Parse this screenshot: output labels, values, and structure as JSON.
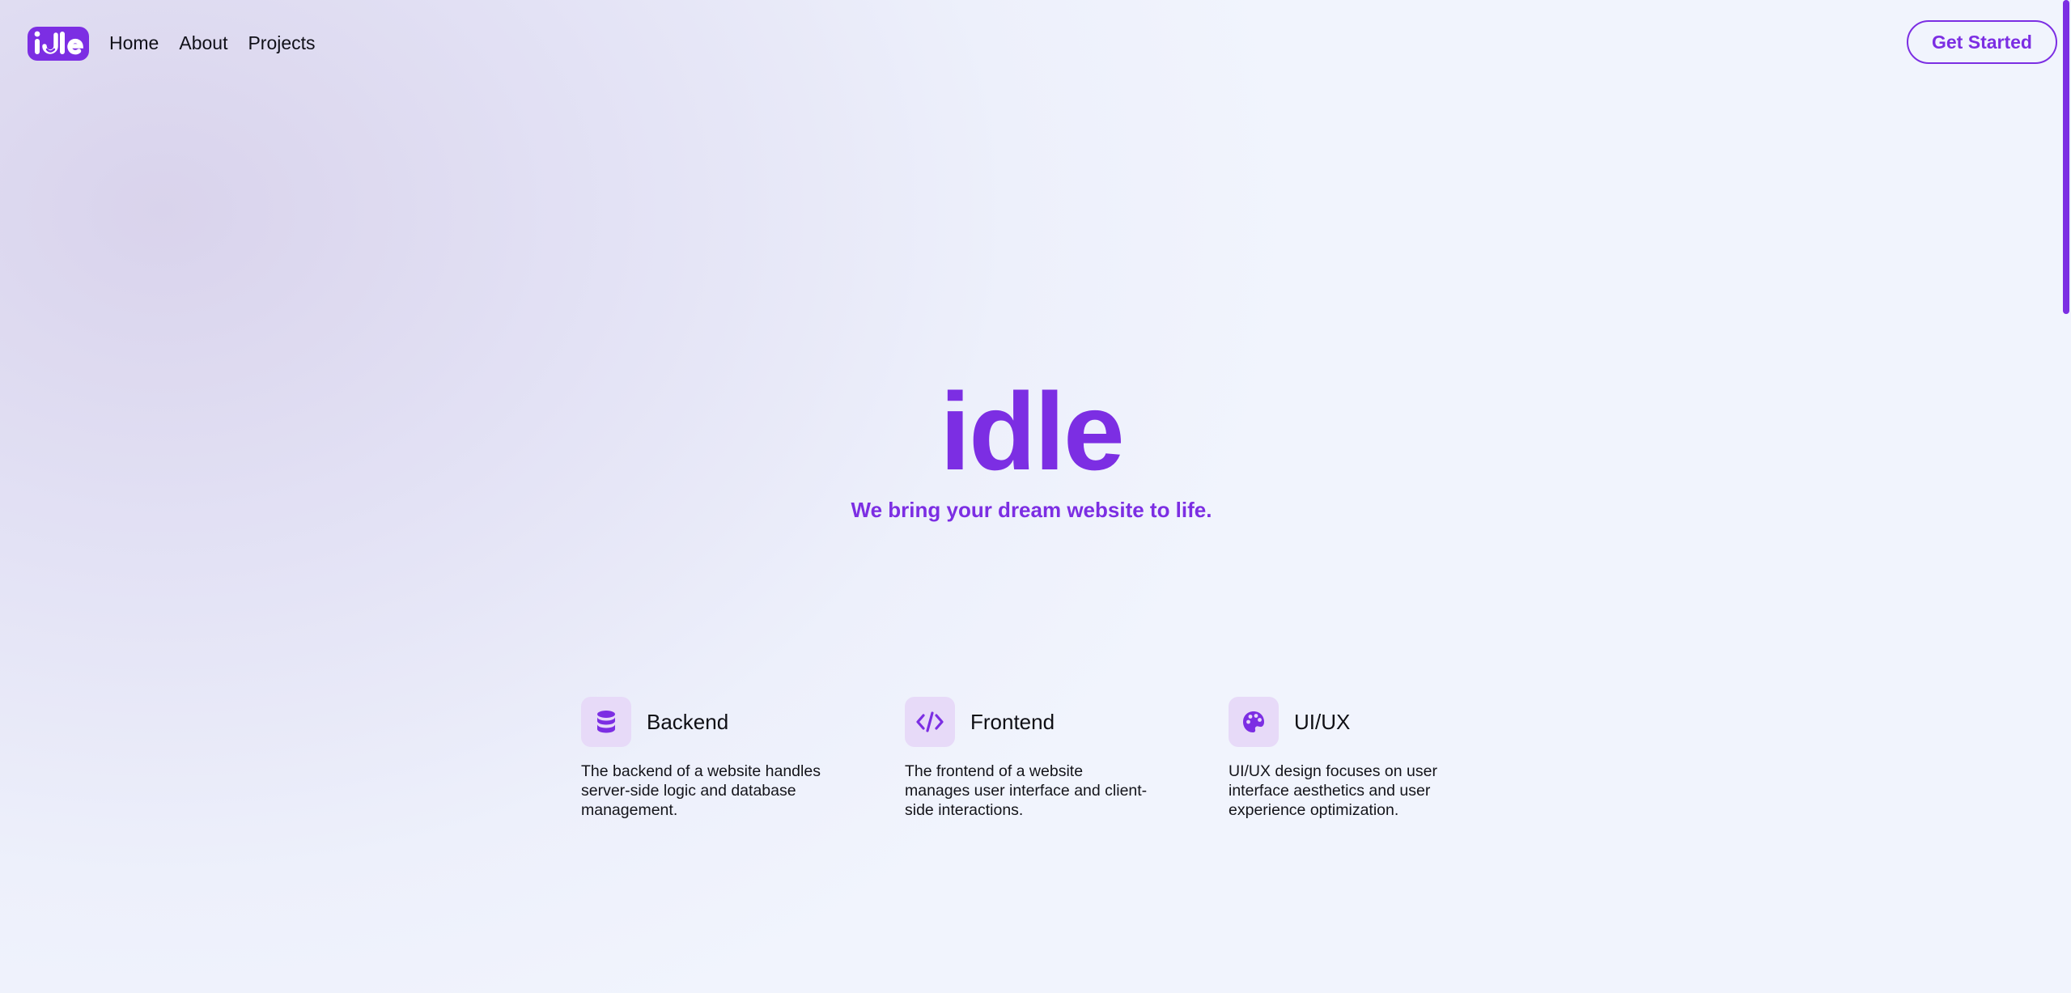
{
  "brand": {
    "logo_text": "idle",
    "accent_color": "#7c2ee3"
  },
  "nav": {
    "links": [
      "Home",
      "About",
      "Projects"
    ],
    "cta_label": "Get Started"
  },
  "hero": {
    "title": "idle",
    "subtitle": "We bring your dream website to life."
  },
  "features": [
    {
      "icon": "database-icon",
      "title": "Backend",
      "description": "The backend of a website handles server-side logic and database management."
    },
    {
      "icon": "code-icon",
      "title": "Frontend",
      "description": "The frontend of a website manages user interface and client-side interactions."
    },
    {
      "icon": "palette-icon",
      "title": "UI/UX",
      "description": "UI/UX design focuses on user interface aesthetics and user experience optimization."
    }
  ]
}
